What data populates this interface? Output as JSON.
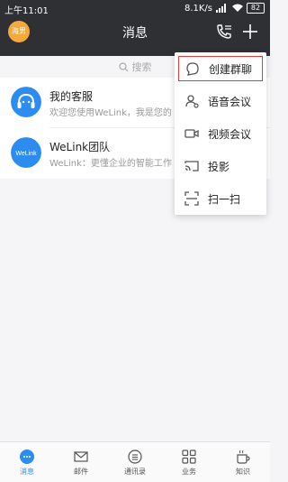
{
  "status": {
    "time": "上午11:01",
    "speed": "8.1K/s",
    "battery": "82"
  },
  "header": {
    "avatar_text": "海男",
    "title": "消息"
  },
  "search": {
    "placeholder": "搜索"
  },
  "conversations": [
    {
      "name": "我的客服",
      "preview": "欢迎您使用WeLink，我是您的"
    },
    {
      "name": "WeLink团队",
      "preview": "WeLink：更懂企业的智能工作",
      "avatar_text": "WeLink"
    }
  ],
  "menu": [
    {
      "label": "创建群聊",
      "icon": "group-chat-icon"
    },
    {
      "label": "语音会议",
      "icon": "voice-meeting-icon"
    },
    {
      "label": "视频会议",
      "icon": "video-meeting-icon"
    },
    {
      "label": "投影",
      "icon": "cast-icon"
    },
    {
      "label": "扫一扫",
      "icon": "scan-icon"
    }
  ],
  "tabs": [
    {
      "label": "消息",
      "icon": "message-icon"
    },
    {
      "label": "邮件",
      "icon": "mail-icon"
    },
    {
      "label": "通讯录",
      "icon": "contacts-icon"
    },
    {
      "label": "业务",
      "icon": "apps-icon"
    },
    {
      "label": "知识",
      "icon": "knowledge-icon"
    }
  ],
  "colors": {
    "header_bg": "#2f3034",
    "accent": "#2d8cf0",
    "highlight": "#e23b3b"
  }
}
